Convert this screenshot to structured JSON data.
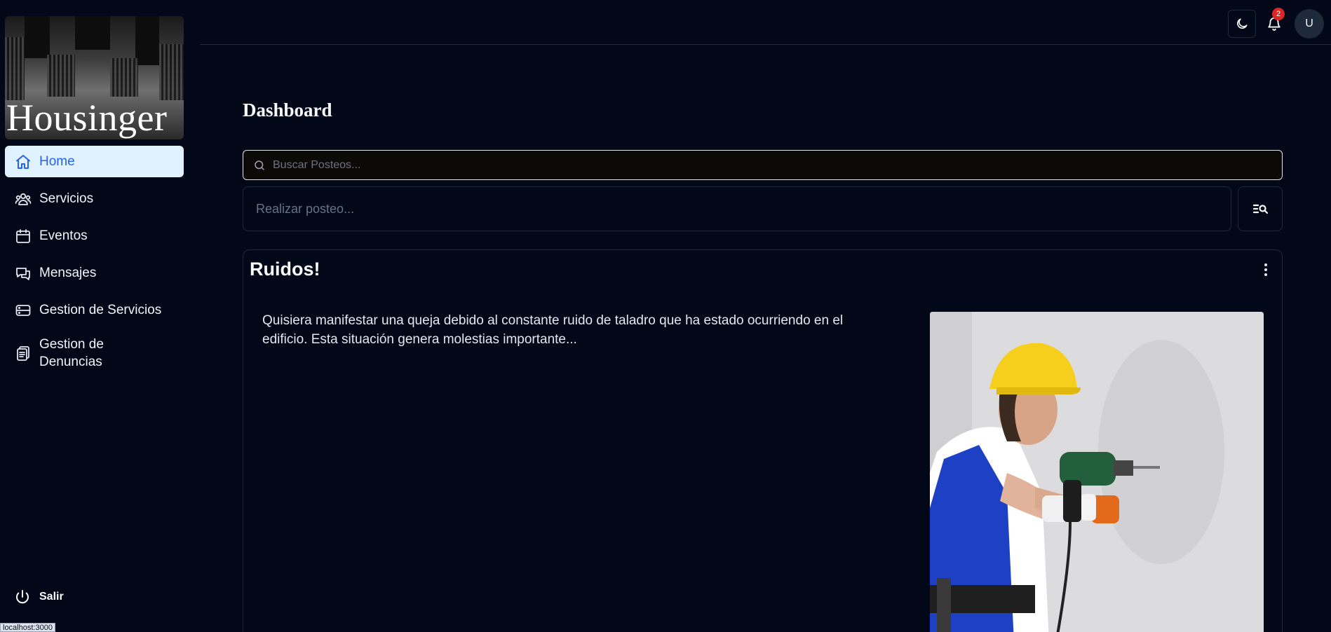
{
  "sidebar": {
    "logo_text": "Housinger",
    "items": [
      {
        "label": "Home",
        "icon": "home-icon",
        "active": true
      },
      {
        "label": "Servicios",
        "icon": "users-icon"
      },
      {
        "label": "Eventos",
        "icon": "calendar-icon"
      },
      {
        "label": "Mensajes",
        "icon": "messages-icon"
      },
      {
        "label": "Gestion de Servicios",
        "icon": "database-icon"
      },
      {
        "label": "Gestion de Denuncias",
        "icon": "clipboard-icon"
      }
    ],
    "logout_label": "Salir"
  },
  "header": {
    "notification_count": "2",
    "avatar_initial": "U"
  },
  "main": {
    "title": "Dashboard",
    "search_placeholder": "Buscar Posteos...",
    "post_placeholder": "Realizar posteo...",
    "post": {
      "title": "Ruidos!",
      "body": "Quisiera manifestar una queja debido al constante ruido de taladro que ha estado ocurriendo en el edificio. Esta situación genera molestias importante..."
    }
  },
  "status_bar_url": "localhost:3000",
  "colors": {
    "background": "#020817",
    "active_nav_bg": "#e0f2fe",
    "active_nav_text": "#2563eb",
    "badge": "#dc2626"
  }
}
